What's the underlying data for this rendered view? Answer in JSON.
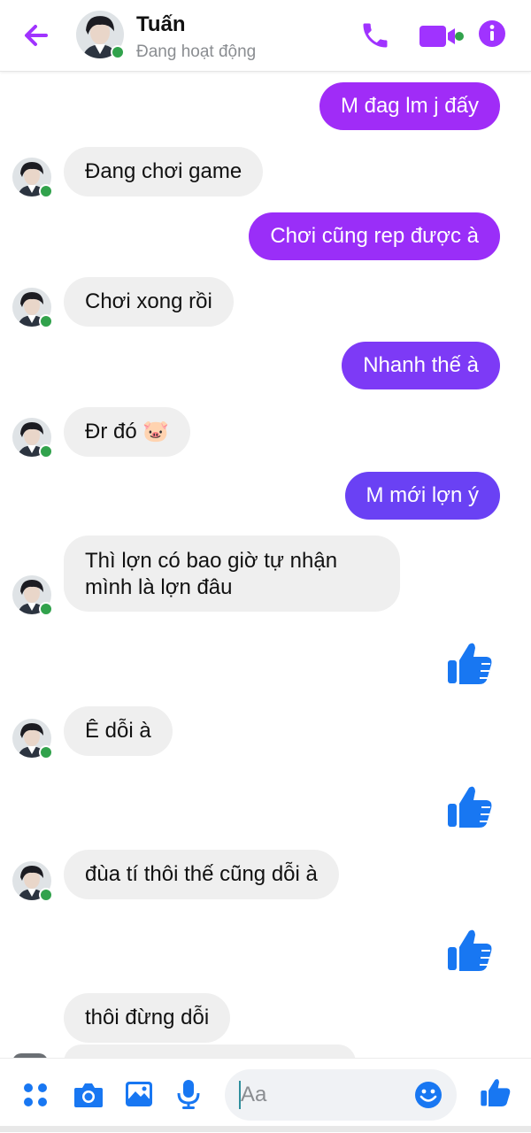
{
  "header": {
    "name": "Tuấn",
    "status": "Đang hoạt động",
    "accent_color": "#a033ff",
    "icons": [
      "back-arrow-icon",
      "phone-icon",
      "video-camera-icon",
      "info-icon"
    ]
  },
  "messages": [
    {
      "from": "me",
      "text": "M đag lm j đấy",
      "color": "#a02cf7"
    },
    {
      "from": "them",
      "text": "Đang chơi game"
    },
    {
      "from": "me",
      "text": "Chơi cũng rep được à",
      "color": "#9a2ef8"
    },
    {
      "from": "them",
      "text": "Chơi xong rồi"
    },
    {
      "from": "me",
      "text": "Nhanh thế à",
      "color": "#7d3af6"
    },
    {
      "from": "them",
      "text": "Đr đó 🐷"
    },
    {
      "from": "me",
      "text": "M mới lợn ý",
      "color": "#6a41f4"
    },
    {
      "from": "them",
      "text": "Thì lợn có bao giờ tự nhận mình là lợn đâu"
    },
    {
      "from": "me",
      "type": "like"
    },
    {
      "from": "them",
      "text": "Ê dỗi à"
    },
    {
      "from": "me",
      "type": "like"
    },
    {
      "from": "them",
      "text": "đùa tí thôi thế cũng dỗi à"
    },
    {
      "from": "me",
      "type": "like"
    },
    {
      "from": "them",
      "text": "thôi đừng dỗi"
    }
  ],
  "composer": {
    "placeholder": "Aa",
    "icons": [
      "apps-icon",
      "camera-icon",
      "image-icon",
      "microphone-icon",
      "emoji-icon",
      "like-icon"
    ]
  },
  "like_color": "#1877f2",
  "online_color": "#31a24c"
}
